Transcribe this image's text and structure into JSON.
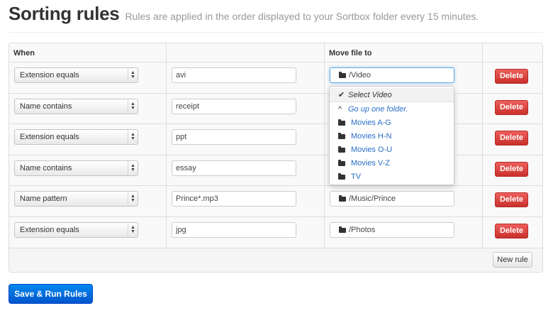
{
  "header": {
    "title": "Sorting rules",
    "subtitle": "Rules are applied in the order displayed to your Sortbox folder every 15 minutes."
  },
  "table": {
    "columns": [
      "When",
      "",
      "Move file to",
      ""
    ],
    "rows": [
      {
        "condition": "Extension equals",
        "value": "avi",
        "destination": "/Video",
        "delete_label": "Delete"
      },
      {
        "condition": "Name contains",
        "value": "receipt",
        "destination": "",
        "delete_label": "Delete"
      },
      {
        "condition": "Extension equals",
        "value": "ppt",
        "destination": "",
        "delete_label": "Delete"
      },
      {
        "condition": "Name contains",
        "value": "essay",
        "destination": "",
        "delete_label": "Delete"
      },
      {
        "condition": "Name pattern",
        "value": "Prince*.mp3",
        "destination": "/Music/Prince",
        "delete_label": "Delete"
      },
      {
        "condition": "Extension equals",
        "value": "jpg",
        "destination": "/Photos",
        "delete_label": "Delete"
      }
    ],
    "new_rule_label": "New rule"
  },
  "folder_dropdown": {
    "select_item": "Select Video",
    "up_item": "Go up one folder.",
    "folders": [
      "Movies A-G",
      "Movies H-N",
      "Movies O-U",
      "Movies V-Z",
      "TV"
    ]
  },
  "save_button": "Save & Run Rules",
  "icons": {
    "folder": "folder-icon",
    "check": "checkmark-icon",
    "up": "chevron-up-icon",
    "select_arrows": "select-arrows-icon"
  },
  "colors": {
    "delete": "#d9534f",
    "primary": "#0066dd",
    "link": "#2a6fc9"
  }
}
